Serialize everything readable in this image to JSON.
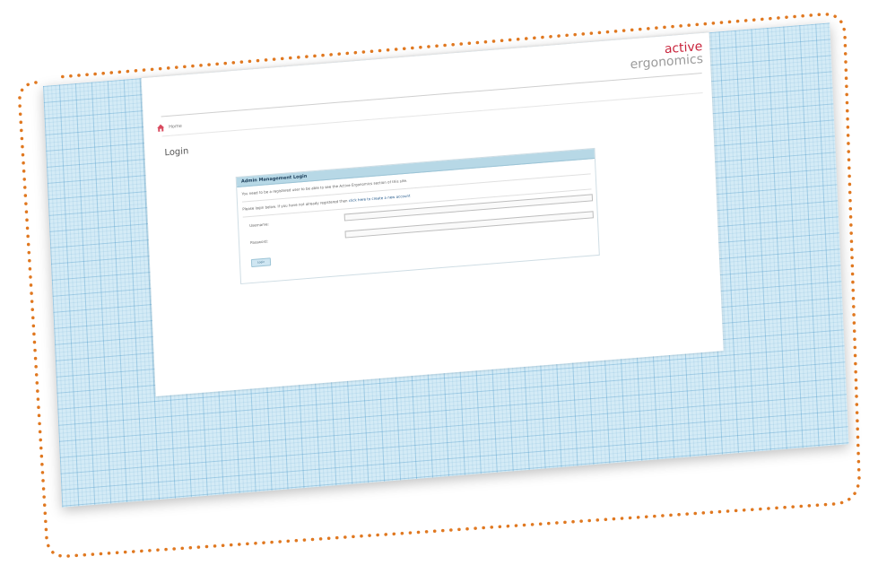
{
  "logo": {
    "line1": "active",
    "line2": "ergonomics"
  },
  "nav": {
    "home_label": "Home"
  },
  "page_title": "Login",
  "login_box": {
    "header": "Admin Management Login",
    "message_1": "You need to be a registered user to be able to see the Active Ergonomics section of this site.",
    "message_2_prefix": "Please login below. If you have not already registered then ",
    "message_2_link": "click here to create a new account",
    "username_label": "Username:",
    "password_label": "Password:",
    "username_value": "",
    "password_value": "",
    "login_button": "Login"
  },
  "colors": {
    "brand_red": "#c8223a",
    "grid_blue": "#d4ebf6",
    "frame_orange": "#e07820"
  }
}
